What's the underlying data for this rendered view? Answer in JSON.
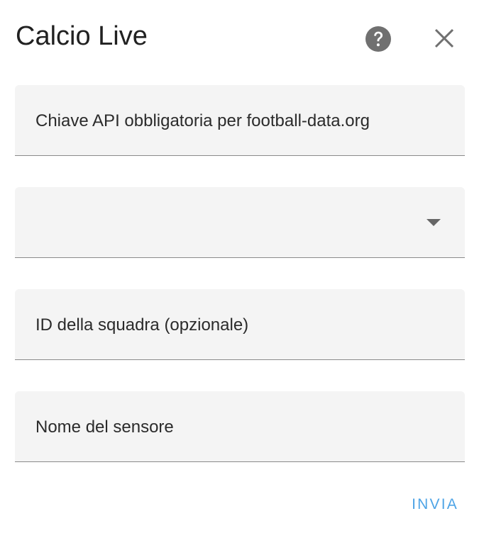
{
  "dialog": {
    "title": "Calcio Live",
    "help_icon": "help-circle-icon",
    "close_icon": "close-icon"
  },
  "form": {
    "fields": [
      {
        "label": "Chiave API obbligatoria per football-data.org",
        "value": ""
      },
      {
        "label": "",
        "value": "",
        "type": "select"
      },
      {
        "label": "ID della squadra (opzionale)",
        "value": ""
      },
      {
        "label": "Nome del sensore",
        "value": ""
      }
    ],
    "dropdown_icon": "chevron-down-icon"
  },
  "actions": {
    "submit_label": "INVIA"
  },
  "colors": {
    "accent": "#4ea4e6",
    "field_background": "#f4f4f4",
    "icon_gray": "#707070"
  }
}
